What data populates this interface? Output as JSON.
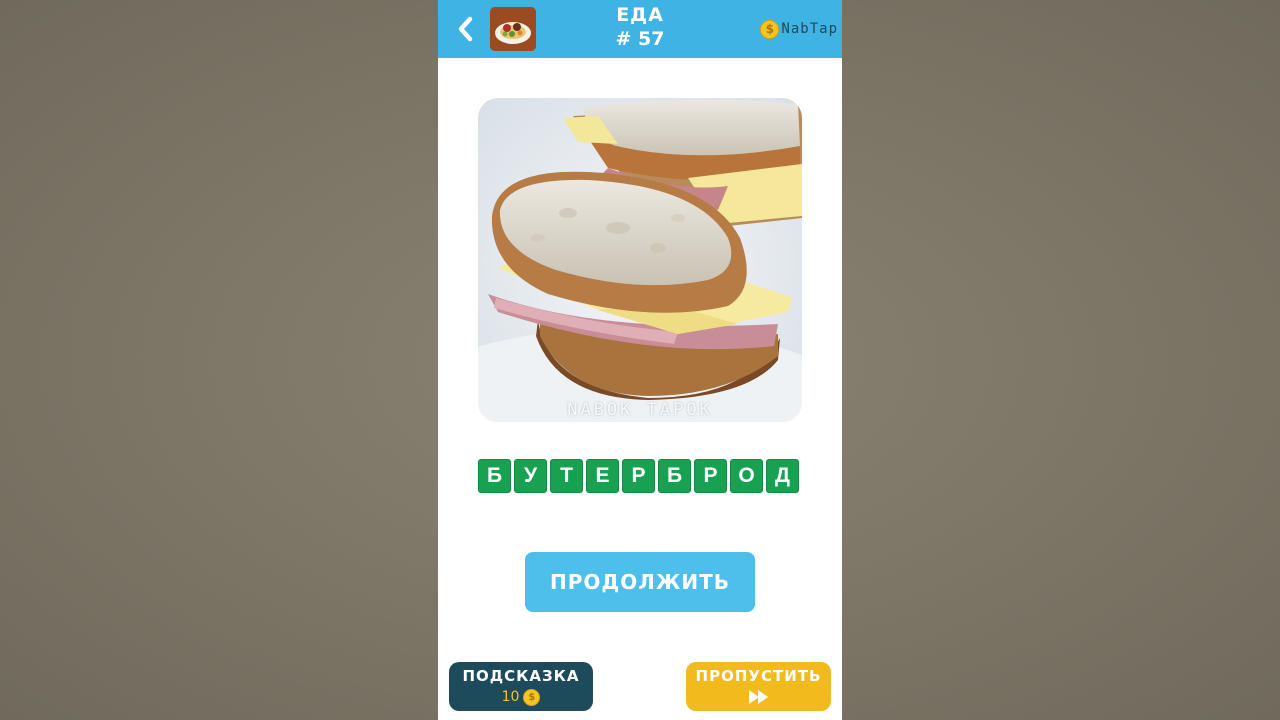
{
  "header": {
    "category": "ЕДА",
    "level": "# 57",
    "coins": {
      "symbol": "$",
      "amount": "NabTap"
    }
  },
  "puzzle": {
    "image_alt": "sandwich with ham and cheese",
    "watermark": "NABOK TAPOK",
    "answer_letters": [
      "Б",
      "У",
      "Т",
      "Е",
      "Р",
      "Б",
      "Р",
      "О",
      "Д"
    ]
  },
  "actions": {
    "continue_label": "ПРОДОЛЖИТЬ",
    "hint_label": "ПОДСКАЗКА",
    "hint_cost": "10",
    "coin_symbol": "$",
    "skip_label": "ПРОПУСТИТЬ"
  },
  "colors": {
    "top_bar": "#3fb3e3",
    "letter_tile": "#19a152",
    "continue_button": "#4dbfea",
    "hint_button": "#1e4b5c",
    "skip_button": "#f1bb1d",
    "coin": "#f3c623"
  },
  "icons": {
    "back": "chevron-left-icon",
    "category": "food-plate-icon",
    "coin": "coin-icon",
    "skip": "fast-forward-icon"
  }
}
